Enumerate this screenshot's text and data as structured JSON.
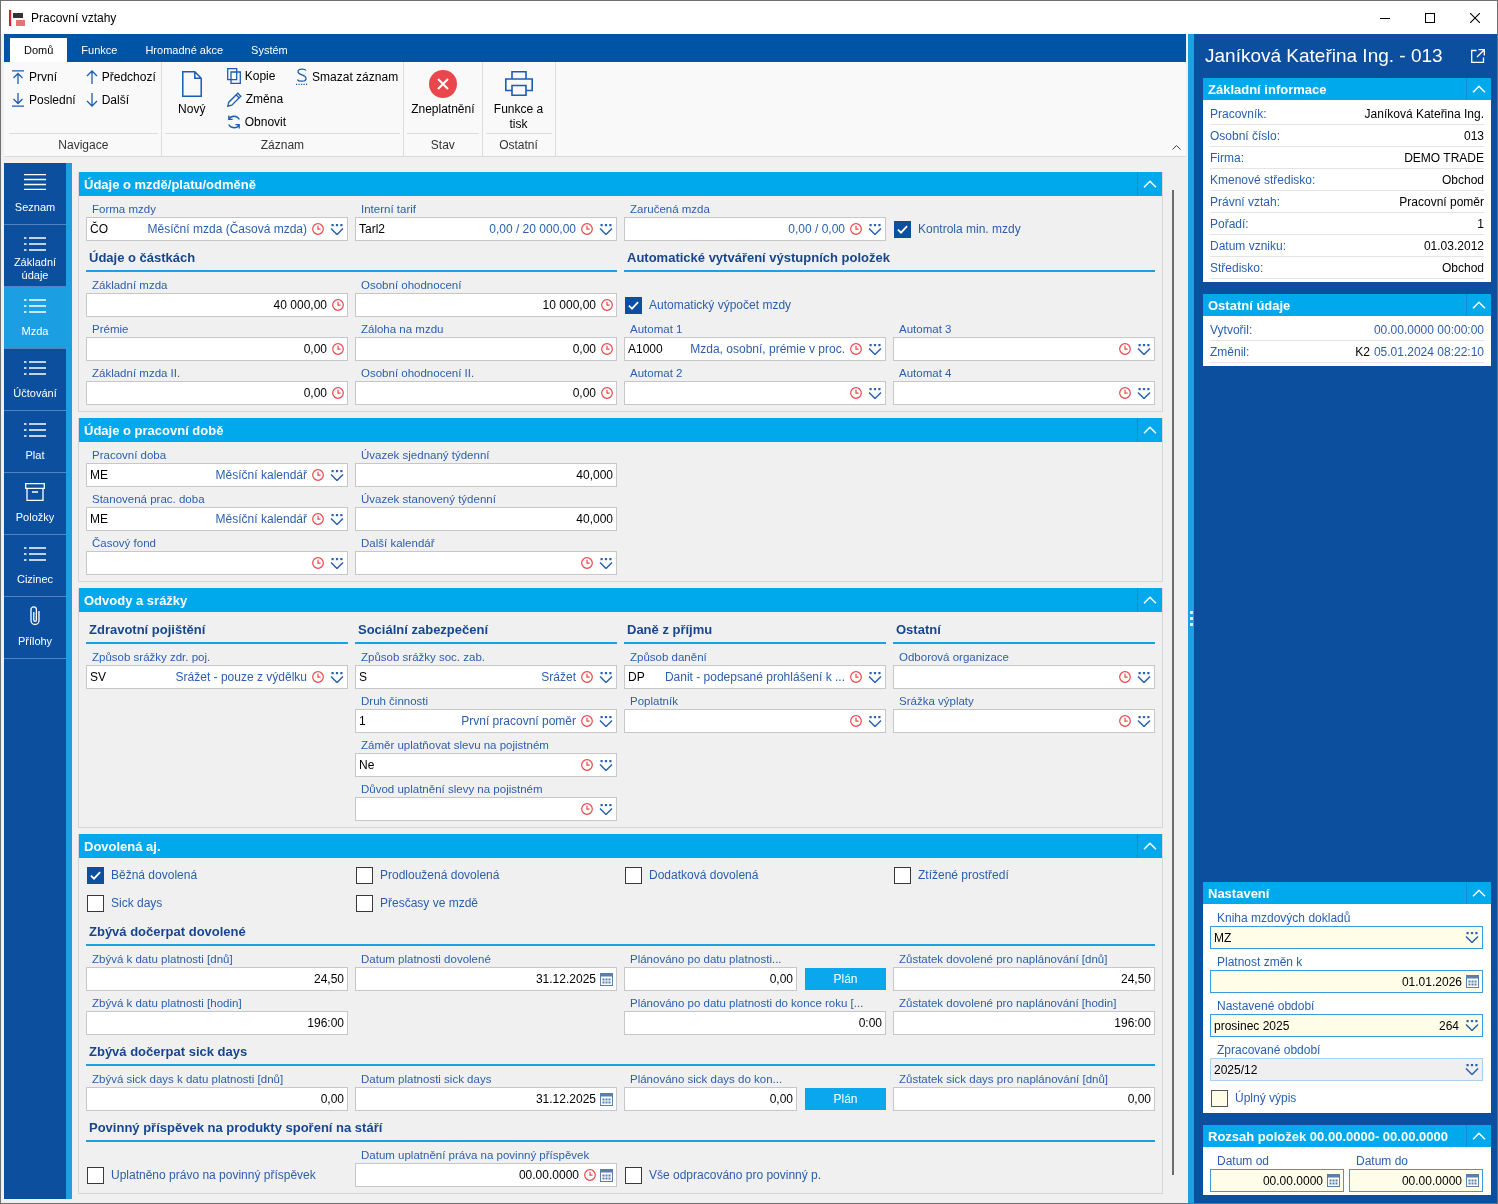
{
  "window": {
    "title": "Pracovní vztahy"
  },
  "ribbon": {
    "tabs": [
      {
        "label": "Domů",
        "selected": true
      },
      {
        "label": "Funkce",
        "selected": false
      },
      {
        "label": "Hromadné akce",
        "selected": false
      },
      {
        "label": "Systém",
        "selected": false
      }
    ],
    "groups": [
      {
        "label": "Navigace",
        "columns": [
          [
            {
              "label": "První",
              "kind": "small"
            },
            {
              "label": "Poslední",
              "kind": "small"
            }
          ],
          [
            {
              "label": "Předchozí",
              "kind": "small"
            },
            {
              "label": "Další",
              "kind": "small"
            }
          ]
        ]
      },
      {
        "label": "Záznam",
        "columns": [
          [
            {
              "label": "Nový",
              "kind": "large"
            }
          ],
          [
            {
              "label": "Kopie",
              "kind": "small"
            },
            {
              "label": "Změna",
              "kind": "small"
            },
            {
              "label": "Obnovit",
              "kind": "small"
            }
          ],
          [
            {
              "label": "Smazat záznam",
              "kind": "small"
            }
          ]
        ]
      },
      {
        "label": "Stav",
        "columns": [
          [
            {
              "label": "Zneplatnění",
              "kind": "large"
            }
          ]
        ]
      },
      {
        "label": "Ostatní",
        "columns": [
          [
            {
              "label": "Funkce a tisk",
              "kind": "large"
            }
          ]
        ]
      }
    ]
  },
  "sidebar": {
    "items": [
      {
        "label": "Seznam",
        "selected": false
      },
      {
        "label": "Základní údaje",
        "selected": false
      },
      {
        "label": "Mzda",
        "selected": true
      },
      {
        "label": "Účtování",
        "selected": false
      },
      {
        "label": "Plat",
        "selected": false
      },
      {
        "label": "Položky",
        "selected": false
      },
      {
        "label": "Cizinec",
        "selected": false
      },
      {
        "label": "Přílohy",
        "selected": false
      }
    ]
  },
  "form": {
    "sections": [
      {
        "title": "Údaje o mzdě/platu/odměně",
        "expanded": true,
        "rows": [
          {
            "kind": "fields",
            "cells": [
              {
                "kind": "field",
                "label": "Forma mzdy",
                "code": "ČO",
                "description": "Měsíční mzda (Časová mzda)",
                "history": true,
                "dropdown": true
              },
              {
                "kind": "field",
                "label": "Interní tarif",
                "code": "Tarl2",
                "description": "0,00 / 20 000,00",
                "history": true,
                "dropdown": true
              },
              {
                "kind": "field",
                "label": "Zaručená mzda",
                "description": "0,00 / 0,00",
                "history": true,
                "dropdown": true
              },
              {
                "kind": "checkbox",
                "label": "Kontrola min. mzdy",
                "checked": true
              }
            ]
          },
          {
            "kind": "headings",
            "cells": [
              "Údaje o částkách",
              null,
              "Automatické vytváření výstupních položek",
              null
            ]
          },
          {
            "kind": "fields",
            "cells": [
              {
                "kind": "field",
                "label": "Základní mzda",
                "value": "40 000,00",
                "history": true
              },
              {
                "kind": "field",
                "label": "Osobní ohodnocení",
                "value": "10 000,00",
                "history": true
              },
              {
                "kind": "checkbox",
                "label": "Automatický výpočet mzdy",
                "checked": true
              }
            ]
          },
          {
            "kind": "fields",
            "cells": [
              {
                "kind": "field",
                "label": "Prémie",
                "value": "0,00",
                "history": true
              },
              {
                "kind": "field",
                "label": "Záloha na mzdu",
                "value": "0,00",
                "history": true
              },
              {
                "kind": "field",
                "label": "Automat 1",
                "code": "A1000",
                "description": "Mzda, osobní, prémie v proc.",
                "history": true,
                "dropdown": true
              },
              {
                "kind": "field",
                "label": "Automat 3",
                "history": true,
                "dropdown": true
              }
            ]
          },
          {
            "kind": "fields",
            "cells": [
              {
                "kind": "field",
                "label": "Základní mzda II.",
                "value": "0,00",
                "history": true
              },
              {
                "kind": "field",
                "label": "Osobní ohodnocení II.",
                "value": "0,00",
                "history": true
              },
              {
                "kind": "field",
                "label": "Automat 2",
                "history": true,
                "dropdown": true
              },
              {
                "kind": "field",
                "label": "Automat 4",
                "history": true,
                "dropdown": true
              }
            ]
          }
        ]
      },
      {
        "title": "Údaje o pracovní době",
        "expanded": true,
        "rows": [
          {
            "kind": "fields",
            "cells": [
              {
                "kind": "field",
                "label": "Pracovní doba",
                "code": "ME",
                "description": "Měsíční kalendář",
                "history": true,
                "dropdown": true
              },
              {
                "kind": "field",
                "label": "Úvazek sjednaný týdenní",
                "value": "40,000"
              }
            ]
          },
          {
            "kind": "fields",
            "cells": [
              {
                "kind": "field",
                "label": "Stanovená prac. doba",
                "code": "ME",
                "description": "Měsíční kalendář",
                "history": true,
                "dropdown": true
              },
              {
                "kind": "field",
                "label": "Úvazek stanovený týdenní",
                "value": "40,000"
              }
            ]
          },
          {
            "kind": "fields",
            "cells": [
              {
                "kind": "field",
                "label": "Časový fond",
                "history": true,
                "dropdown": true
              },
              {
                "kind": "field",
                "label": "Další kalendář",
                "history": true,
                "dropdown": true
              }
            ]
          }
        ]
      },
      {
        "title": "Odvody a srážky",
        "expanded": true,
        "rows": [
          {
            "kind": "headings",
            "cells": [
              "Zdravotní pojištění",
              "Sociální zabezpečení",
              "Daně z příjmu",
              "Ostatní"
            ]
          },
          {
            "kind": "fields",
            "cells": [
              {
                "kind": "field",
                "label": "Způsob srážky zdr. poj.",
                "code": "SV",
                "description": "Srážet - pouze z výdělku",
                "history": true,
                "dropdown": true
              },
              {
                "kind": "field",
                "label": "Způsob srážky soc. zab.",
                "code": "S",
                "description": "Srážet",
                "history": true,
                "dropdown": true
              },
              {
                "kind": "field",
                "label": "Způsob danění",
                "code": "DP",
                "description": "Danit - podepsané prohlášení k ...",
                "history": true,
                "dropdown": true
              },
              {
                "kind": "field",
                "label": "Odborová organizace",
                "history": true,
                "dropdown": true
              }
            ]
          },
          {
            "kind": "fields",
            "cells": [
              null,
              {
                "kind": "field",
                "label": "Druh činnosti",
                "code": "1",
                "description": "První pracovní poměr",
                "history": true,
                "dropdown": true
              },
              {
                "kind": "field",
                "label": "Poplatník",
                "history": true,
                "dropdown": true
              },
              {
                "kind": "field",
                "label": "Srážka výplaty",
                "history": true,
                "dropdown": true
              }
            ]
          },
          {
            "kind": "fields",
            "cells": [
              null,
              {
                "kind": "field",
                "label": "Záměr uplatňovat slevu na pojistném",
                "code": "Ne",
                "history": true,
                "dropdown": true
              }
            ]
          },
          {
            "kind": "fields",
            "cells": [
              null,
              {
                "kind": "field",
                "label": "Důvod uplatnění slevy na pojistném",
                "history": true,
                "dropdown": true
              }
            ]
          }
        ]
      },
      {
        "title": "Dovolená aj.",
        "expanded": true,
        "rows": [
          {
            "kind": "fields",
            "cells": [
              {
                "kind": "checkbox",
                "label": "Běžná dovolená",
                "checked": true
              },
              {
                "kind": "checkbox",
                "label": "Prodloužená dovolená",
                "checked": false
              },
              {
                "kind": "checkbox",
                "label": "Dodatková dovolená",
                "checked": false
              },
              {
                "kind": "checkbox",
                "label": "Ztížené prostředí",
                "checked": false
              }
            ]
          },
          {
            "kind": "fields",
            "cells": [
              {
                "kind": "checkbox",
                "label": "Sick days",
                "checked": false
              },
              {
                "kind": "checkbox",
                "label": "Přesčasy ve mzdě",
                "checked": false
              }
            ]
          },
          {
            "kind": "headings",
            "cells": [
              "Zbývá dočerpat dovolené",
              null,
              null,
              null
            ]
          },
          {
            "kind": "fields",
            "cells": [
              {
                "kind": "field",
                "label": "Zbývá k datu platnosti [dnů]",
                "value": "24,50"
              },
              {
                "kind": "field",
                "label": "Datum platnosti dovolené",
                "value": "31.12.2025",
                "calendar": true
              },
              {
                "kind": "field",
                "label": "Plánováno po datu platnosti...",
                "value": "0,00",
                "button": "Plán"
              },
              {
                "kind": "field",
                "label": "Zůstatek dovolené pro naplánování [dnů]",
                "value": "24,50"
              }
            ]
          },
          {
            "kind": "fields",
            "cells": [
              {
                "kind": "field",
                "label": "Zbývá k datu platnosti [hodin]",
                "value": "196:00"
              },
              null,
              {
                "kind": "field",
                "label": "Plánováno po datu platnosti do konce roku [...",
                "value": "0:00"
              },
              {
                "kind": "field",
                "label": "Zůstatek dovolené pro naplánování [hodin]",
                "value": "196:00"
              }
            ]
          },
          {
            "kind": "headings",
            "cells": [
              "Zbývá dočerpat sick days",
              null,
              null,
              null
            ]
          },
          {
            "kind": "fields",
            "cells": [
              {
                "kind": "field",
                "label": "Zbývá sick days k datu platnosti [dnů]",
                "value": "0,00"
              },
              {
                "kind": "field",
                "label": "Datum platnosti sick days",
                "value": "31.12.2025",
                "calendar": true
              },
              {
                "kind": "field",
                "label": "Plánováno sick days do kon...",
                "value": "0,00",
                "button": "Plán"
              },
              {
                "kind": "field",
                "label": "Zůstatek sick days pro naplánování [dnů]",
                "value": "0,00"
              }
            ]
          },
          {
            "kind": "headings",
            "cells": [
              "Povinný příspěvek na produkty spoření na stáří",
              null,
              null,
              null
            ]
          },
          {
            "kind": "fields",
            "cells": [
              {
                "kind": "checkbox",
                "label": "Uplatněno právo na povinný příspěvek",
                "checked": false
              },
              {
                "kind": "field",
                "label": "Datum uplatnění práva na povinný příspěvek",
                "value": "00.00.0000",
                "history": true,
                "calendar": true
              },
              {
                "kind": "checkbox",
                "label": "Vše odpracováno pro povinný p.",
                "checked": false
              }
            ]
          }
        ]
      }
    ]
  },
  "detail_panel": {
    "title": "Janíková Kateřina Ing. - 013",
    "sections": [
      {
        "title": "Základní informace",
        "expanded": true,
        "kind": "details",
        "rows": [
          {
            "label": "Pracovník:",
            "value": "Janíková Kateřina Ing."
          },
          {
            "label": "Osobní číslo:",
            "value": "013"
          },
          {
            "label": "Firma:",
            "value": "DEMO TRADE"
          },
          {
            "label": "Kmenové středisko:",
            "value": "Obchod"
          },
          {
            "label": "Právní vztah:",
            "value": "Pracovní poměr"
          },
          {
            "label": "Pořadí:",
            "value": "1"
          },
          {
            "label": "Datum vzniku:",
            "value": "01.03.2012"
          },
          {
            "label": "Středisko:",
            "value": "Obchod"
          }
        ]
      },
      {
        "title": "Ostatní údaje",
        "expanded": true,
        "kind": "audit",
        "rows": [
          {
            "label": "Vytvořil:",
            "value": "00.00.0000 00:00:00"
          },
          {
            "label": "Změnil:",
            "user": "K2",
            "value": "05.01.2024 08:22:10"
          }
        ]
      },
      {
        "title": "Nastavení",
        "expanded": true,
        "kind": "settings",
        "rows": [
          {
            "kind": "field",
            "label": "Kniha mzdových dokladů",
            "code": "MZ",
            "dropdown": true,
            "disabled": false
          },
          {
            "kind": "field",
            "label": "Platnost změn k",
            "value": "01.01.2026",
            "calendar": true,
            "disabled": false
          },
          {
            "kind": "field",
            "label": "Nastavené období",
            "code": "prosinec 2025",
            "value": "264",
            "dropdown": true,
            "disabled": false
          },
          {
            "kind": "field",
            "label": "Zpracované období",
            "code": "2025/12",
            "dropdown": true,
            "disabled": true
          },
          {
            "kind": "checkbox",
            "label": "Úplný výpis",
            "checked": false
          }
        ]
      },
      {
        "title": "Rozsah položek 00.00.0000- 00.00.0000",
        "expanded": true,
        "kind": "range",
        "rows": [
          {
            "kind": "field",
            "label": "Datum od",
            "value": "00.00.0000",
            "calendar": true,
            "disabled": false
          },
          {
            "kind": "field",
            "label": "Datum do",
            "value": "00.00.0000",
            "calendar": true,
            "disabled": false
          }
        ]
      }
    ]
  }
}
